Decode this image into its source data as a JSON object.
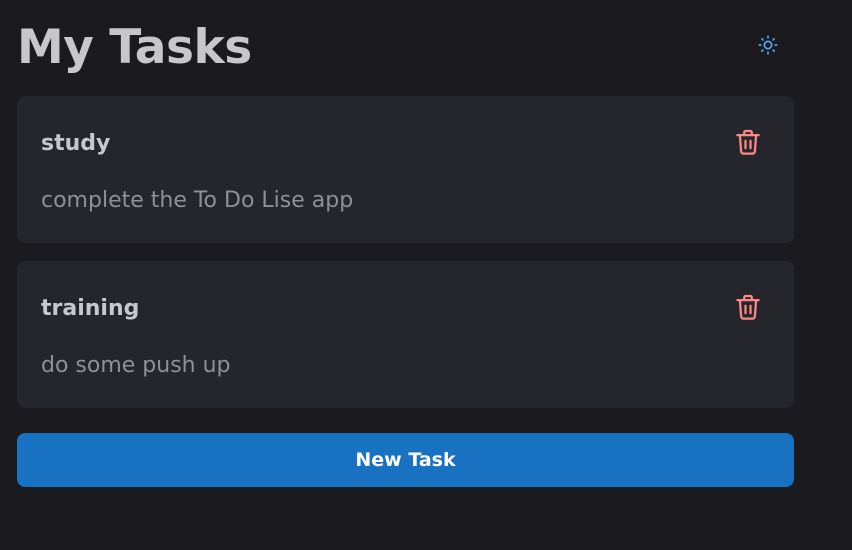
{
  "header": {
    "title": "My Tasks",
    "theme_icon": "sun-icon"
  },
  "tasks": [
    {
      "title": "study",
      "description": "complete the To Do Lise app",
      "delete_icon": "trash-icon"
    },
    {
      "title": "training",
      "description": "do some push up",
      "delete_icon": "trash-icon"
    }
  ],
  "actions": {
    "new_task_label": "New Task"
  },
  "colors": {
    "background": "#1b1b1f",
    "card": "#25262b",
    "accent": "#1971c2",
    "danger": "#ff8787",
    "sun": "#4dabf7"
  }
}
